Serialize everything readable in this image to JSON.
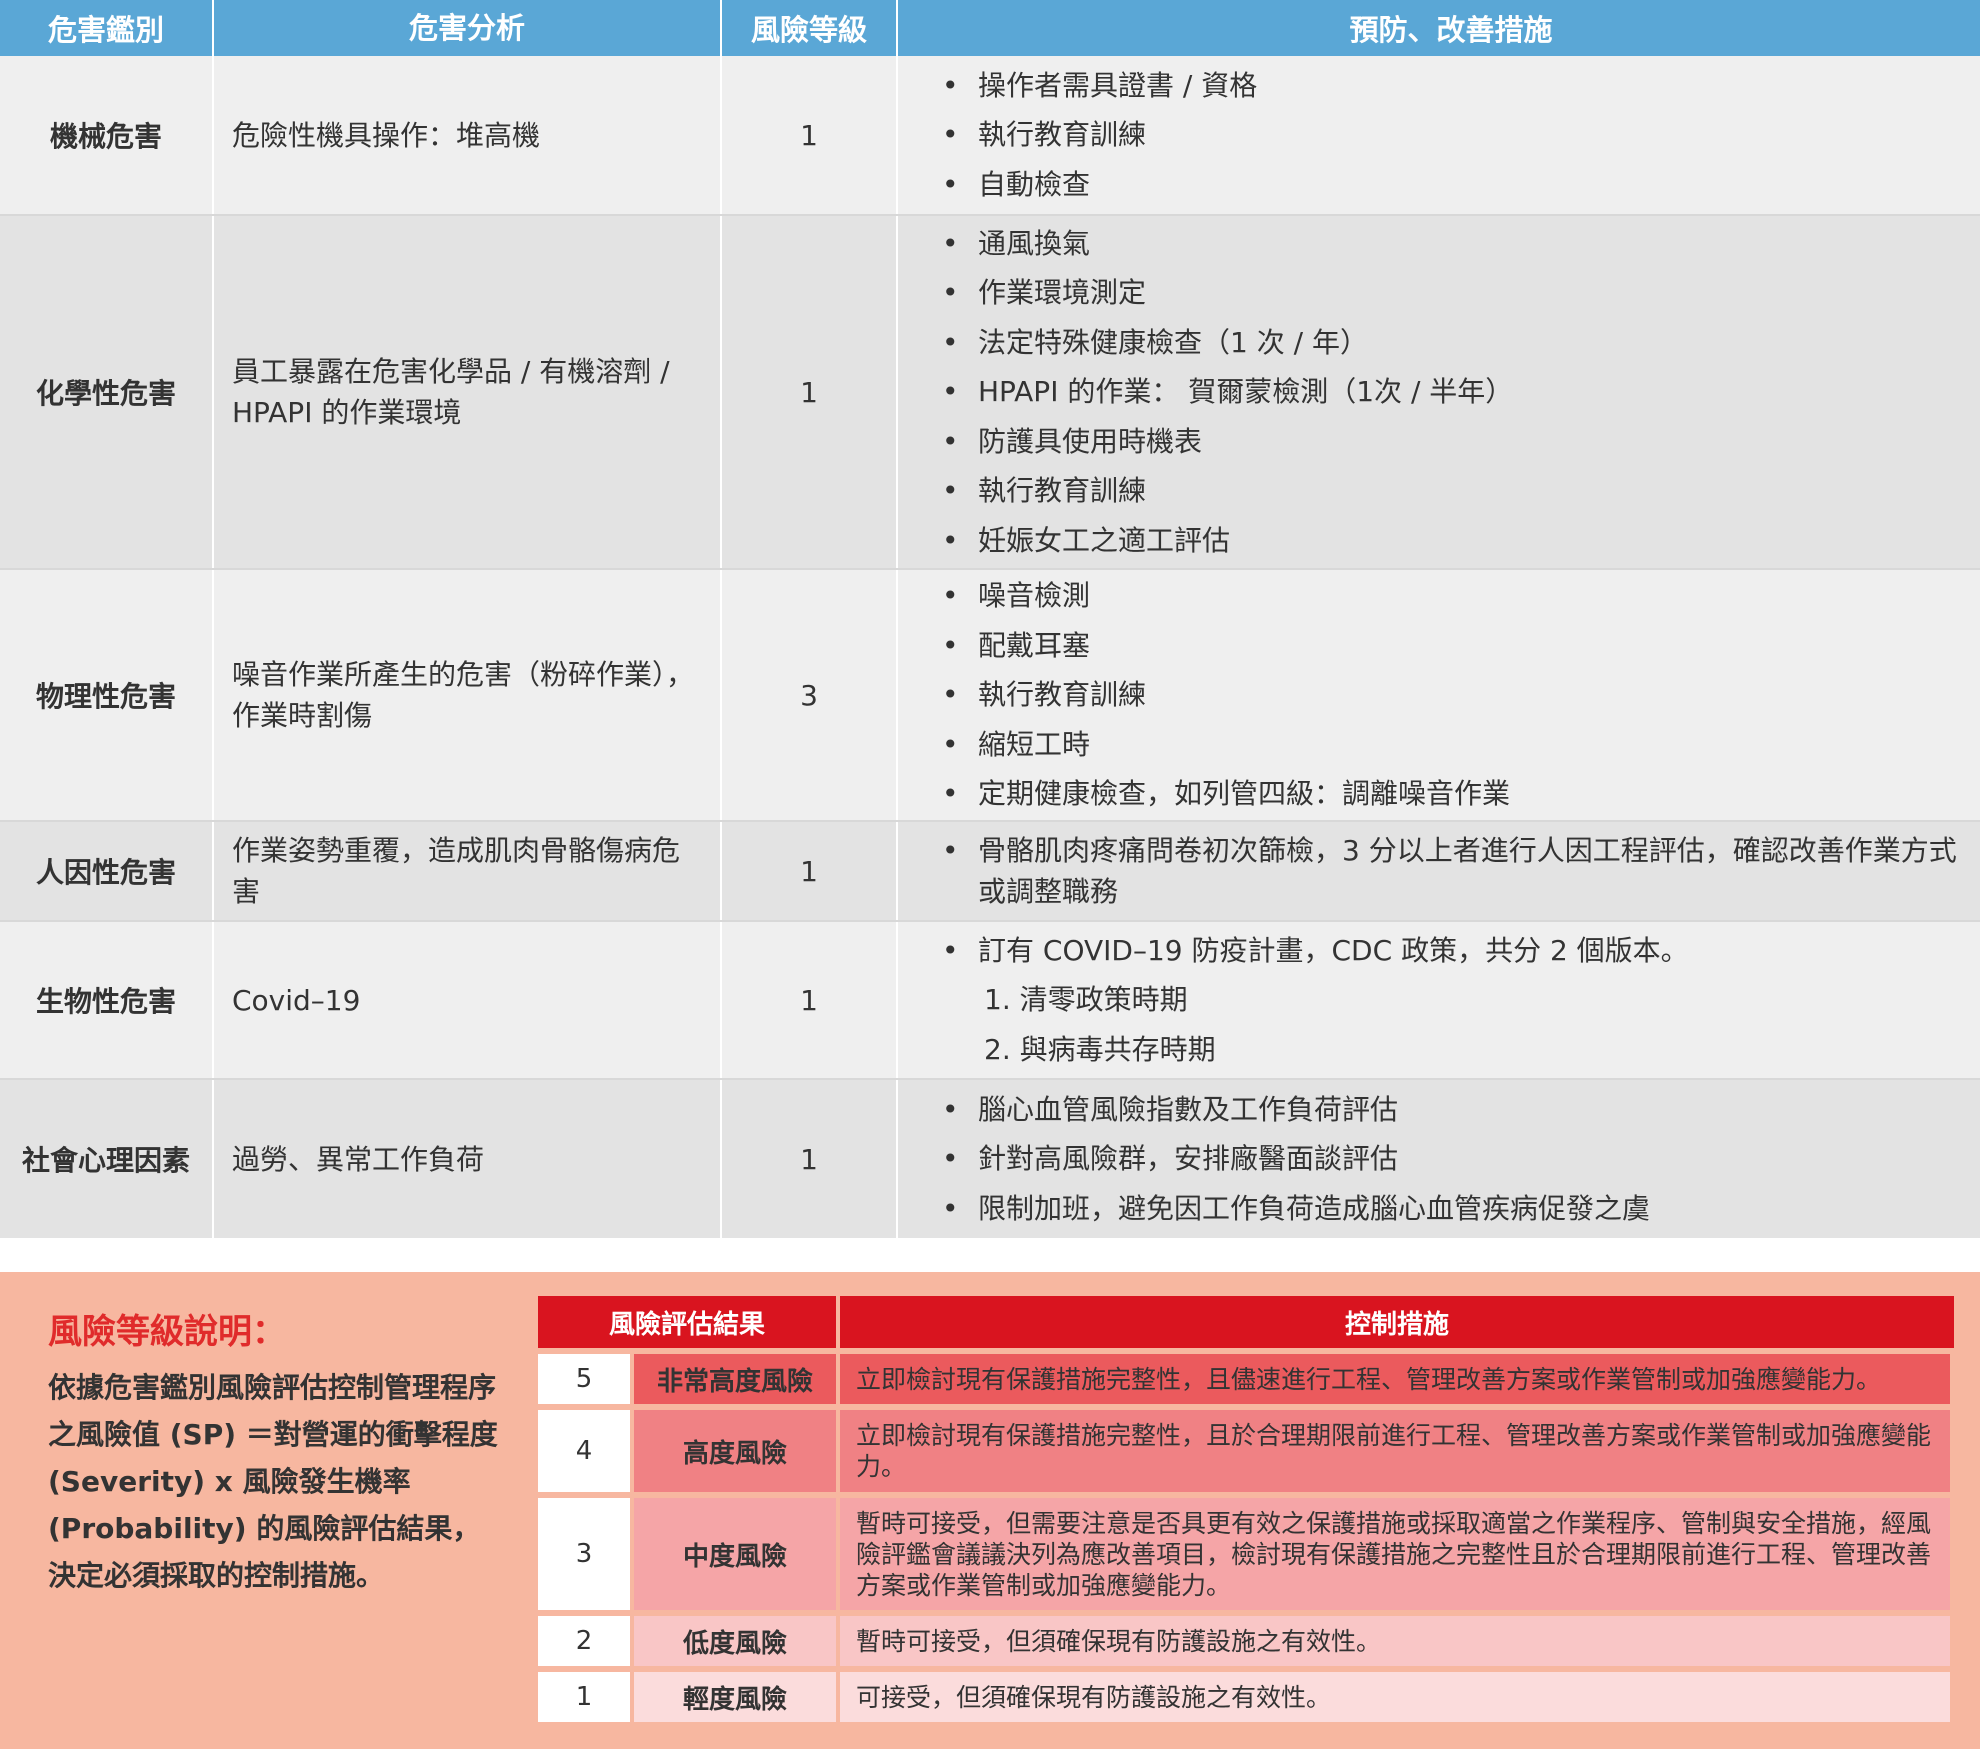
{
  "table": {
    "headers": [
      "危害鑑別",
      "危害分析",
      "風險等級",
      "預防、改善措施"
    ],
    "rows": [
      {
        "type": "機械危害",
        "analysis": "危險性機具操作：堆高機",
        "level": "1",
        "measures": [
          "操作者需具證書 / 資格",
          "執行教育訓練",
          "自動檢查"
        ]
      },
      {
        "type": "化學性危害",
        "analysis": "員工暴露在危害化學品 / 有機溶劑 / HPAPI 的作業環境",
        "level": "1",
        "measures": [
          "通風換氣",
          "作業環境測定",
          "法定特殊健康檢查（1 次 / 年）",
          "HPAPI 的作業： 賀爾蒙檢測（1次 / 半年）",
          "防護具使用時機表",
          "執行教育訓練",
          "妊娠女工之適工評估"
        ]
      },
      {
        "type": "物理性危害",
        "analysis": "噪音作業所產生的危害（粉碎作業），作業時割傷",
        "level": "3",
        "measures": [
          "噪音檢測",
          "配戴耳塞",
          "執行教育訓練",
          "縮短工時",
          "定期健康檢查，如列管四級：調離噪音作業"
        ]
      },
      {
        "type": "人因性危害",
        "analysis": "作業姿勢重覆，造成肌肉骨骼傷病危害",
        "level": "1",
        "measures": [
          "骨骼肌肉疼痛問卷初次篩檢，3 分以上者進行人因工程評估，確認改善作業方式或調整職務"
        ]
      },
      {
        "type": "生物性危害",
        "analysis": "Covid–19",
        "level": "1",
        "measures": [
          "訂有 COVID–19 防疫計畫，CDC 政策，共分 2 個版本。",
          "1. 清零政策時期",
          "2. 與病毒共存時期"
        ]
      },
      {
        "type": "社會心理因素",
        "analysis": "過勞、異常工作負荷",
        "level": "1",
        "measures": [
          "腦心血管風險指數及工作負荷評估",
          "針對高風險群，安排廠醫面談評估",
          "限制加班，避免因工作負荷造成腦心血管疾病促發之虞"
        ]
      }
    ]
  },
  "legend": {
    "title": "風險等級說明：",
    "description": "依據危害鑑別風險評估控制管理程序之風險值 (SP) ＝對營運的衝擊程度 (Severity) x 風險發生機率 (Probability) 的風險評估結果，決定必須採取的控制措施。",
    "headers": [
      "風險評估結果",
      "控制措施"
    ],
    "rows": [
      {
        "num": "5",
        "level": "非常高度風險",
        "action": "立即檢討現有保護措施完整性，且儘速進行工程、管理改善方案或作業管制或加強應變能力。",
        "color": "#eb5a5d"
      },
      {
        "num": "4",
        "level": "高度風險",
        "action": "立即檢討現有保護措施完整性，且於合理期限前進行工程、管理改善方案或作業管制或加強應變能力。",
        "color": "#f08184"
      },
      {
        "num": "3",
        "level": "中度風險",
        "action": "暫時可接受，但需要注意是否具更有效之保護措施或採取適當之作業程序、管制與安全措施，經風險評鑑會議議決列為應改善項目，檢討現有保護措施之完整性且於合理期限前進行工程、管理改善方案或作業管制或加強應變能力。",
        "color": "#f5a5a7"
      },
      {
        "num": "2",
        "level": "低度風險",
        "action": "暫時可接受，但須確保現有防護設施之有效性。",
        "color": "#f9c6c6"
      },
      {
        "num": "1",
        "level": "輕度風險",
        "action": "可接受，但須確保現有防護設施之有效性。",
        "color": "#fbdcdc"
      }
    ]
  }
}
